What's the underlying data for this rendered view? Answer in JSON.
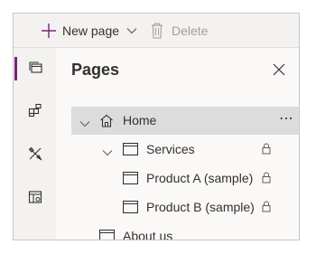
{
  "toolbar": {
    "new_page_label": "New page",
    "delete_label": "Delete"
  },
  "rail": {
    "items": [
      {
        "icon": "pages-icon",
        "active": true
      },
      {
        "icon": "components-icon",
        "active": false
      },
      {
        "icon": "themes-icon",
        "active": false
      },
      {
        "icon": "settings-layout-icon",
        "active": false
      }
    ]
  },
  "pages_pane": {
    "title": "Pages",
    "tree": [
      {
        "label": "Home",
        "level": 0,
        "expanded": true,
        "selected": true,
        "locked": false,
        "icon": "home-icon"
      },
      {
        "label": "Services",
        "level": 1,
        "expanded": true,
        "selected": false,
        "locked": true,
        "icon": "page-icon"
      },
      {
        "label": "Product A (sample)",
        "level": 2,
        "selected": false,
        "locked": true,
        "icon": "page-icon"
      },
      {
        "label": "Product B (sample)",
        "level": 2,
        "selected": false,
        "locked": true,
        "icon": "page-icon"
      },
      {
        "label": "About us",
        "level": 0,
        "selected": false,
        "locked": false,
        "icon": "page-icon"
      }
    ],
    "more_glyph": "⋯"
  },
  "colors": {
    "accent": "#742774",
    "toolbar_bg": "#f3f2f1",
    "pane_bg": "#faf9f8",
    "selected_row": "#dcdcdc",
    "disabled_text": "#a19f9d"
  }
}
